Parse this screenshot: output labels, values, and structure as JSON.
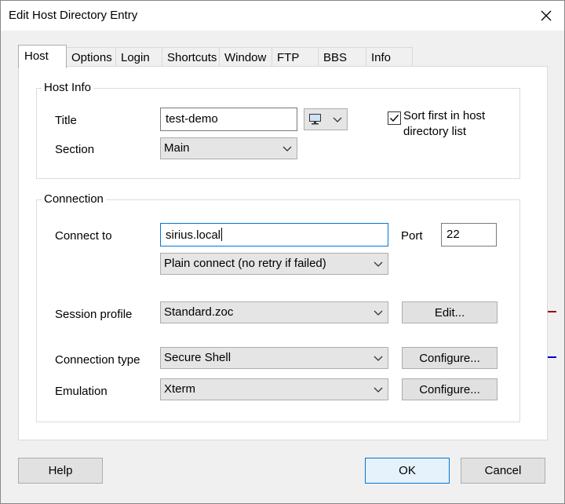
{
  "window": {
    "title": "Edit Host Directory Entry",
    "close_icon": "close-icon"
  },
  "tabs": [
    {
      "label": "Host",
      "active": true
    },
    {
      "label": "Options"
    },
    {
      "label": "Login"
    },
    {
      "label": "Shortcuts"
    },
    {
      "label": "Window"
    },
    {
      "label": "FTP"
    },
    {
      "label": "BBS"
    },
    {
      "label": "Info"
    }
  ],
  "host_info": {
    "group_label": "Host Info",
    "title_label": "Title",
    "title_value": "test-demo",
    "icon_picker": "monitor-icon",
    "section_label": "Section",
    "section_value": "Main",
    "sort_first_label_line1": "Sort first in host",
    "sort_first_label_line2": "directory list",
    "sort_first_checked": true
  },
  "connection": {
    "group_label": "Connection",
    "connect_to_label": "Connect to",
    "connect_to_value": "sirius.local",
    "port_label": "Port",
    "port_value": "22",
    "connect_mode_value": "Plain connect (no retry if failed)",
    "session_profile_label": "Session profile",
    "session_profile_value": "Standard.zoc",
    "edit_button": "Edit...",
    "connection_type_label": "Connection type",
    "connection_type_value": "Secure Shell",
    "configure_type_button": "Configure...",
    "emulation_label": "Emulation",
    "emulation_value": "Xterm",
    "configure_emulation_button": "Configure..."
  },
  "footer": {
    "help_button": "Help",
    "ok_button": "OK",
    "cancel_button": "Cancel"
  },
  "colors": {
    "accent": "#0078d7",
    "arrow_red": "#990000",
    "arrow_blue": "#0000cc"
  }
}
